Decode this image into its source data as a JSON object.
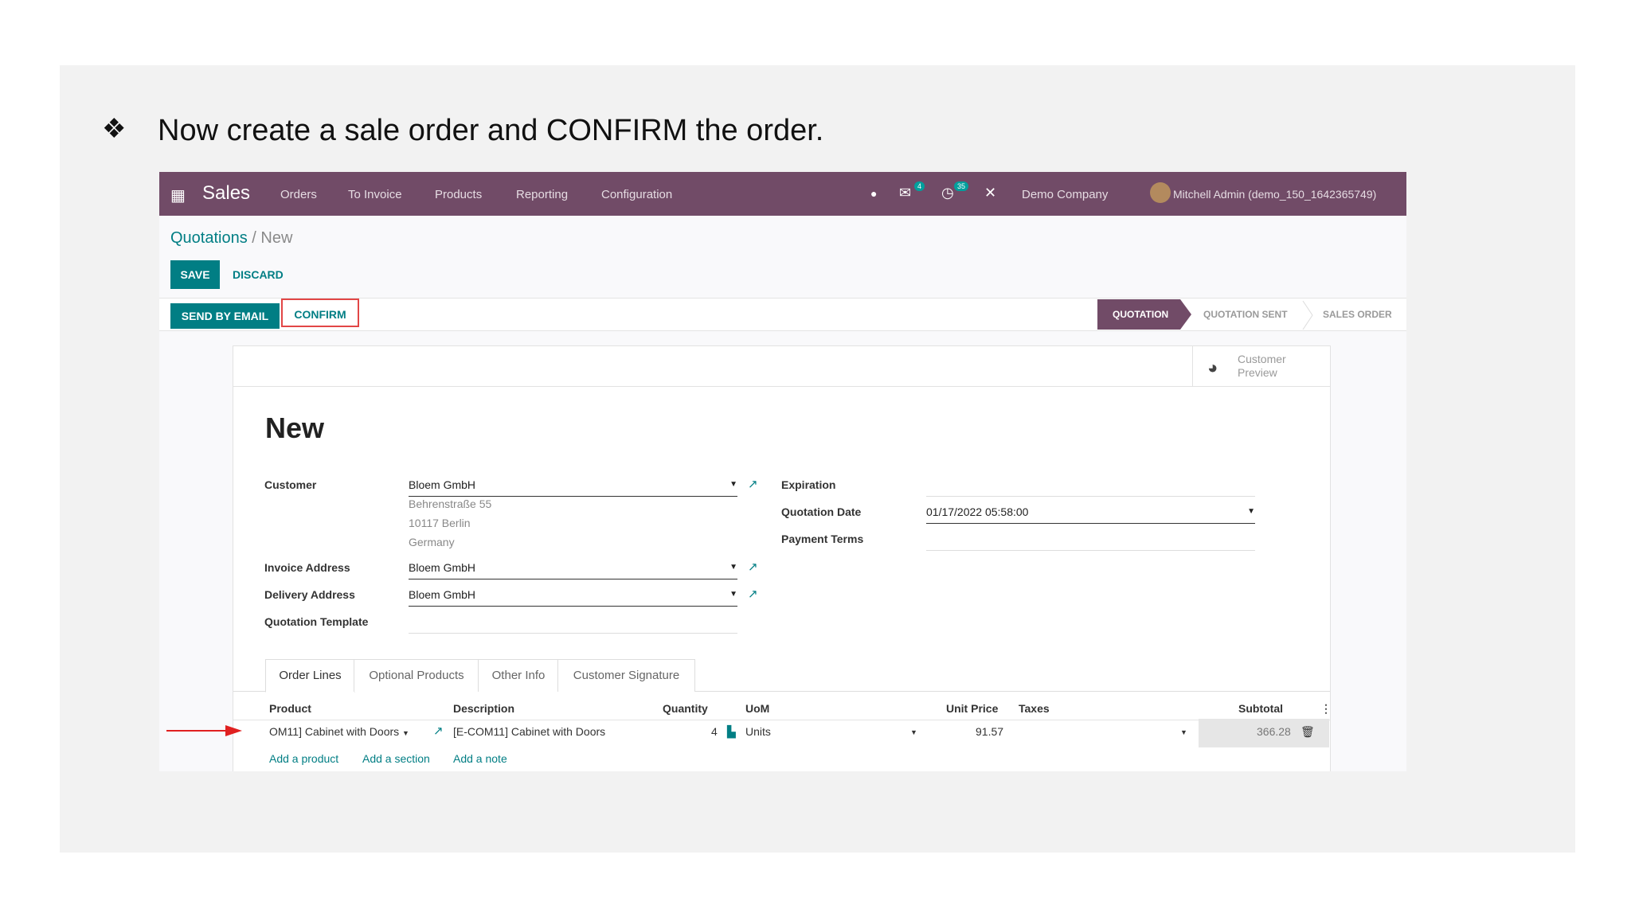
{
  "slide": {
    "bullet": "❖",
    "heading": "Now create a sale order and CONFIRM the order."
  },
  "topbar": {
    "app": "Sales",
    "menu": [
      "Orders",
      "To Invoice",
      "Products",
      "Reporting",
      "Configuration"
    ],
    "badges": {
      "messages": "4",
      "activities": "35"
    },
    "company": "Demo Company",
    "user": "Mitchell Admin (demo_150_1642365749)",
    "colors": {
      "bar": "#714b67",
      "primary": "#017e84",
      "highlight": "#e24646"
    }
  },
  "breadcrumb": {
    "parent": "Quotations",
    "sep": "/",
    "current": "New"
  },
  "buttons": {
    "save": "SAVE",
    "discard": "DISCARD",
    "send_email": "SEND BY EMAIL",
    "confirm": "CONFIRM"
  },
  "statusbar": {
    "stages": [
      "QUOTATION",
      "QUOTATION SENT",
      "SALES ORDER"
    ],
    "active": "QUOTATION"
  },
  "preview": {
    "line1": "Customer",
    "line2": "Preview"
  },
  "form": {
    "title": "New",
    "customer_label": "Customer",
    "customer": "Bloem GmbH",
    "address": [
      "Behrenstraße 55",
      "10117 Berlin",
      "Germany"
    ],
    "invoice_label": "Invoice Address",
    "invoice": "Bloem GmbH",
    "delivery_label": "Delivery Address",
    "delivery": "Bloem GmbH",
    "template_label": "Quotation Template",
    "expiration_label": "Expiration",
    "date_label": "Quotation Date",
    "date": "01/17/2022 05:58:00",
    "terms_label": "Payment Terms"
  },
  "tabs": [
    "Order Lines",
    "Optional Products",
    "Other Info",
    "Customer Signature"
  ],
  "table": {
    "headers": {
      "product": "Product",
      "description": "Description",
      "quantity": "Quantity",
      "uom": "UoM",
      "price": "Unit Price",
      "taxes": "Taxes",
      "subtotal": "Subtotal"
    },
    "row": {
      "product": "OM11] Cabinet with Doors",
      "description": "[E-COM11] Cabinet with Doors",
      "quantity": "4",
      "uom": "Units",
      "price": "91.57",
      "subtotal": "366.28"
    },
    "add_product": "Add a product",
    "add_section": "Add a section",
    "add_note": "Add a note"
  }
}
